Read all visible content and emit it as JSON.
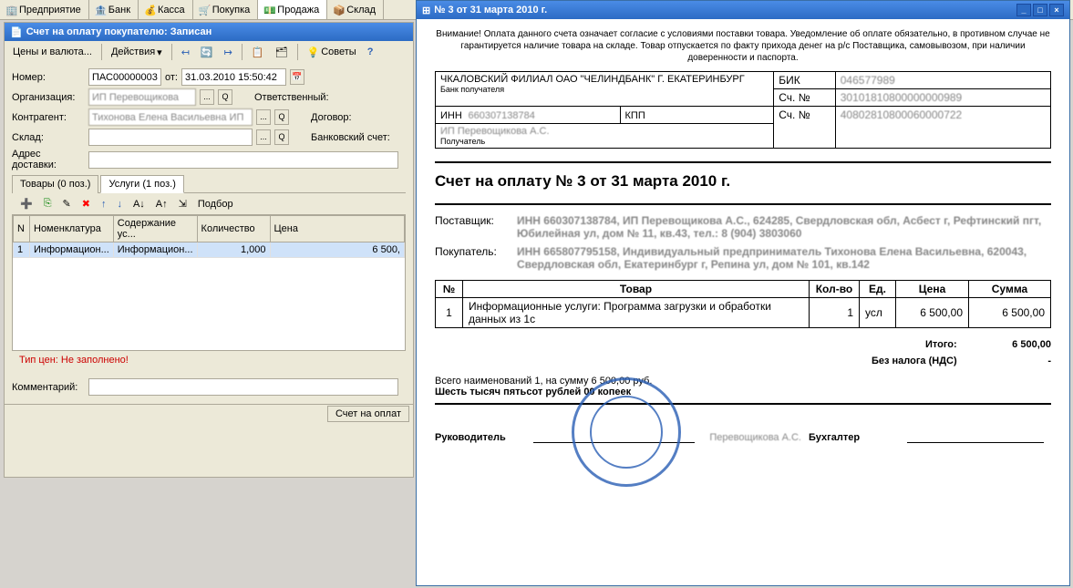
{
  "main_tabs": [
    {
      "label": "Предприятие",
      "icon": "building-icon"
    },
    {
      "label": "Банк",
      "icon": "bank-icon"
    },
    {
      "label": "Касса",
      "icon": "cash-icon"
    },
    {
      "label": "Покупка",
      "icon": "cart-icon"
    },
    {
      "label": "Продажа",
      "icon": "sale-icon",
      "active": true
    },
    {
      "label": "Склад",
      "icon": "warehouse-icon"
    }
  ],
  "left_window": {
    "title": "Счет на оплату покупателю: Записан",
    "toolbar": {
      "prices_label": "Цены и валюта...",
      "actions_label": "Действия",
      "advice_label": "Советы"
    },
    "fields": {
      "number_lbl": "Номер:",
      "number": "ПАС00000003",
      "from_lbl": "от:",
      "date": "31.03.2010 15:50:42",
      "org_lbl": "Организация:",
      "org": "ИП Перевощикова",
      "counterparty_lbl": "Контрагент:",
      "counterparty": "Тихонова Елена Васильевна ИП",
      "warehouse_lbl": "Склад:",
      "warehouse": "",
      "address_lbl": "Адрес доставки:",
      "address": "",
      "responsible_lbl": "Ответственный:",
      "contract_lbl": "Договор:",
      "bank_account_lbl": "Банковский счет:"
    },
    "tabs": {
      "tab1": "Товары (0 поз.)",
      "tab2": "Услуги (1 поз.)"
    },
    "grid_toolbar": {
      "podbor": "Подбор"
    },
    "grid": {
      "headers": {
        "n": "N",
        "nomen": "Номенклатура",
        "cont": "Содержание ус...",
        "qty": "Количество",
        "price": "Цена"
      },
      "row": {
        "n": "1",
        "nomen": "Информацион...",
        "cont": "Информацион...",
        "qty": "1,000",
        "price": "6 500,"
      }
    },
    "status": "Тип цен: Не заполнено!",
    "comment_lbl": "Комментарий:",
    "comment": "",
    "footer_btn": "Счет на оплат"
  },
  "right_window": {
    "title": "№ 3 от 31 марта 2010 г.",
    "disclaimer": "Внимание! Оплата данного счета означает согласие с условиями поставки товара. Уведомление об оплате обязательно, в противном случае не гарантируется наличие товара на складе. Товар отпускается по факту прихода денег на р/с Поставщика, самовывозом, при наличии доверенности и паспорта.",
    "bank": {
      "bank_name": "ЧКАЛОВСКИЙ ФИЛИАЛ ОАО \"ЧЕЛИНДБАНК\" Г. ЕКАТЕРИНБУРГ",
      "bank_label": "Банк получателя",
      "bik_lbl": "БИК",
      "bik": "046577989",
      "acc_lbl": "Сч. №",
      "corr_acc": "30101810800000000989",
      "inn_lbl": "ИНН",
      "inn": "660307138784",
      "kpp_lbl": "КПП",
      "kpp": "",
      "acc2_lbl": "Сч. №",
      "acc": "40802810800060000722",
      "recipient": "ИП Перевощикова А.С.",
      "recipient_lbl": "Получатель"
    },
    "doc_title": "Счет на оплату № 3 от 31 марта 2010 г.",
    "supplier_lbl": "Поставщик:",
    "supplier": "ИНН 660307138784, ИП Перевощикова А.С., 624285, Свердловская обл, Асбест г, Рефтинский пгт, Юбилейная ул, дом № 11, кв.43, тел.: 8 (904) 3803060",
    "buyer_lbl": "Покупатель:",
    "buyer": "ИНН 665807795158, Индивидуальный предприниматель Тихонова Елена Васильевна, 620043, Свердловская обл, Екатеринбург г, Репина ул, дом № 101, кв.142",
    "items_hdr": {
      "n": "№",
      "goods": "Товар",
      "qty": "Кол-во",
      "unit": "Ед.",
      "price": "Цена",
      "sum": "Сумма"
    },
    "items": [
      {
        "n": "1",
        "goods": "Информационные услуги: Программа загрузки и обработки данных из 1с",
        "qty": "1",
        "unit": "усл",
        "price": "6 500,00",
        "sum": "6 500,00"
      }
    ],
    "total_lbl": "Итого:",
    "total": "6 500,00",
    "notax_lbl": "Без налога (НДС)",
    "notax": "-",
    "summary": "Всего наименований 1, на сумму 6 500,00 руб.",
    "amount_words": "Шесть тысяч пятьсот рублей 00 копеек",
    "director_lbl": "Руководитель",
    "director_name": "Перевощикова А.С.",
    "accountant_lbl": "Бухгалтер"
  }
}
